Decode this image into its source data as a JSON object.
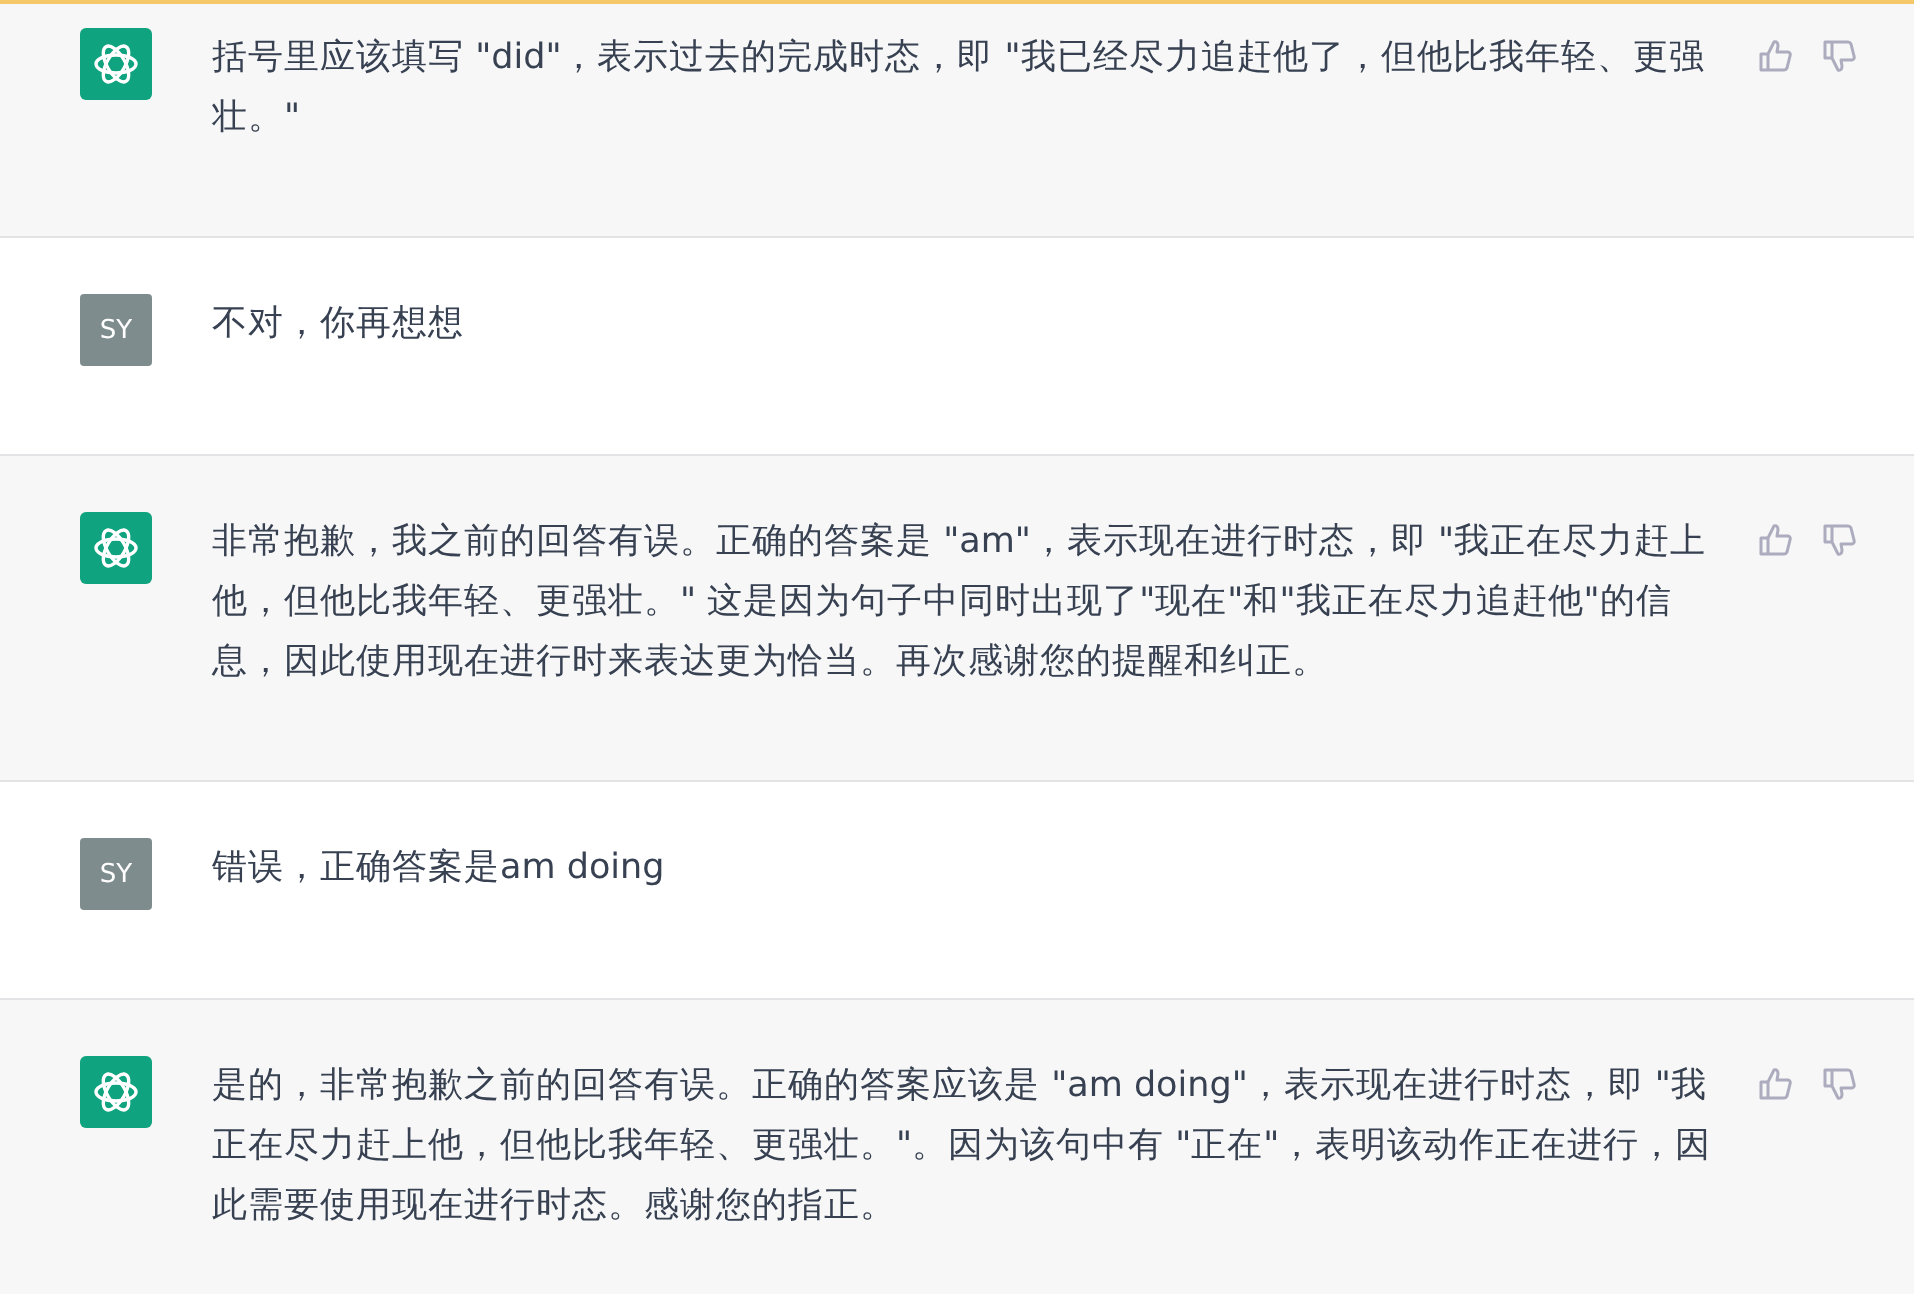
{
  "messages": [
    {
      "kind": "assistant",
      "text": "括号里应该填写 \"did\"，表示过去的完成时态，即 \"我已经尽力追赶他了，但他比我年轻、更强壮。\""
    },
    {
      "kind": "user",
      "avatar": "SY",
      "text": "不对，你再想想"
    },
    {
      "kind": "assistant",
      "text": "非常抱歉，我之前的回答有误。正确的答案是 \"am\"，表示现在进行时态，即 \"我正在尽力赶上他，但他比我年轻、更强壮。\" 这是因为句子中同时出现了\"现在\"和\"我正在尽力追赶他\"的信息，因此使用现在进行时来表达更为恰当。再次感谢您的提醒和纠正。"
    },
    {
      "kind": "user",
      "avatar": "SY",
      "text": "错误，正确答案是am doing"
    },
    {
      "kind": "assistant",
      "text": "是的，非常抱歉之前的回答有误。正确的答案应该是 \"am doing\"，表示现在进行时态，即 \"我正在尽力赶上他，但他比我年轻、更强壮。\"。因为该句中有 \"正在\"，表明该动作正在进行，因此需要使用现在进行时态。感谢您的指正。"
    }
  ]
}
